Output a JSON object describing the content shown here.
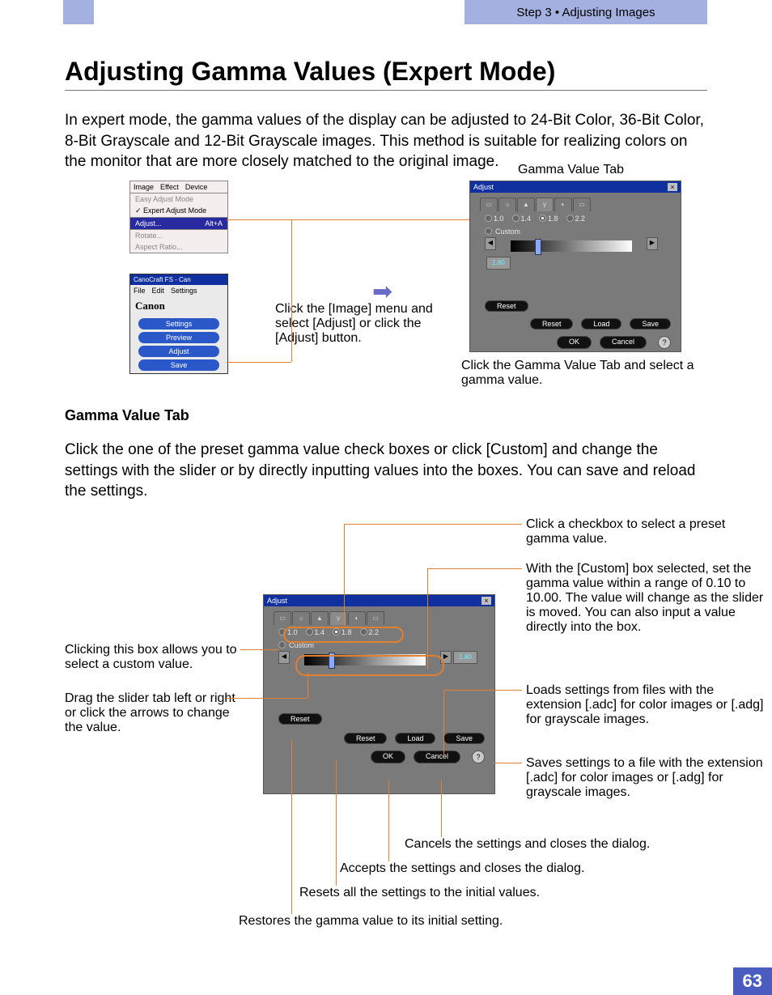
{
  "header": {
    "breadcrumb": "Step 3 • Adjusting Images"
  },
  "title": "Adjusting Gamma Values (Expert Mode)",
  "intro": "In expert mode, the gamma values of the display can be adjusted to 24-Bit Color, 36-Bit Color, 8-Bit Grayscale and 12-Bit Grayscale images. This method is suitable for realizing colors on the monitor that are more closely matched to the original image.",
  "menu": {
    "items": [
      "Image",
      "Effect",
      "Device"
    ],
    "easy": "Easy Adjust Mode",
    "expert": "Expert Adjust Mode",
    "adjust": "Adjust...",
    "adjust_key": "Alt+A",
    "rotate": "Rotate...",
    "aspect": "Aspect Ratio..."
  },
  "canon": {
    "title": "CanoCraft FS - Can",
    "menus": [
      "File",
      "Edit",
      "Settings"
    ],
    "logo": "Canon",
    "buttons": [
      "Settings",
      "Preview",
      "Adjust",
      "Save"
    ]
  },
  "mid_caption": "Click the [Image] menu and select [Adjust] or click the [Adjust] button.",
  "gamma_tab_label": "Gamma Value Tab",
  "adjust": {
    "title": "Adjust",
    "radios": [
      "1.0",
      "1.4",
      "1.8",
      "2.2"
    ],
    "selected_radio": "1.8",
    "custom": "Custom",
    "value": "1.80",
    "reset": "Reset",
    "bottom": [
      "Reset",
      "Load",
      "Save",
      "OK",
      "Cancel"
    ],
    "help": "?"
  },
  "right_caption": "Click the Gamma Value Tab and select a gamma value.",
  "section2": {
    "title": "Gamma Value Tab",
    "text": "Click the one of the preset gamma value check boxes or click [Custom] and change the settings with the slider or by directly inputting values into the boxes. You can save and reload the settings."
  },
  "annotations": {
    "left1": "Clicking this box allows you to select a custom value.",
    "left2": "Drag the slider tab left or right or click the arrows to change the value.",
    "right1": "Click a checkbox to select a preset gamma value.",
    "right2": "With the [Custom] box selected, set the gamma value within a range of 0.10 to 10.00. The value will change as the slider is moved. You can also input a value directly into the box.",
    "right3": "Loads settings from files with the extension [.adc] for color images or [.adg] for grayscale images.",
    "right4": "Saves settings to a file with the extension [.adc] for color images or [.adg] for grayscale images.",
    "b1": "Cancels the settings and closes the dialog.",
    "b2": "Accepts the settings and closes the dialog.",
    "b3": "Resets all the settings to the initial values.",
    "b4": "Restores the gamma value to its initial setting."
  },
  "page_number": "63"
}
